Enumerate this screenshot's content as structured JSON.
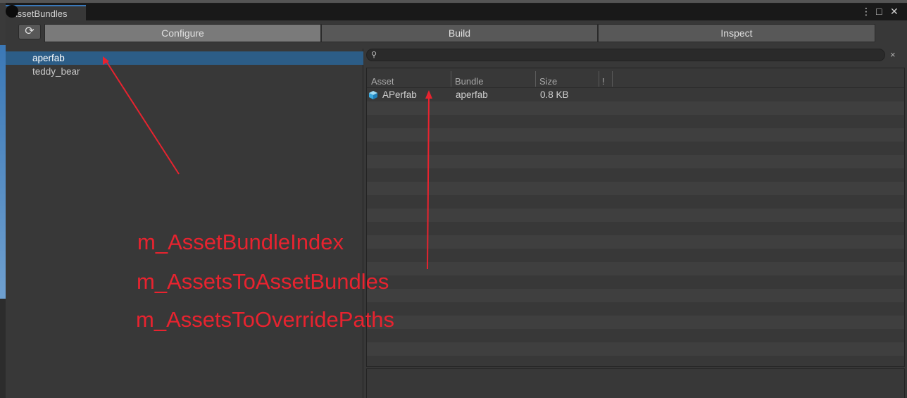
{
  "window": {
    "tab_title": "AssetBundles",
    "menu_glyph": "⋮",
    "maximize_glyph": "□",
    "close_glyph": "✕"
  },
  "toolbar": {
    "refresh_glyph": "⟳",
    "tabs": [
      "Configure",
      "Build",
      "Inspect"
    ],
    "active_tab": "Configure"
  },
  "bundles": {
    "items": [
      "aperfab",
      "teddy_bear"
    ],
    "selected": "aperfab"
  },
  "search": {
    "value": "",
    "search_glyph": "🔍",
    "clear_glyph": "×"
  },
  "asset_table": {
    "columns": [
      "Asset",
      "Bundle",
      "Size",
      "!"
    ],
    "rows": [
      {
        "icon": "prefab-icon",
        "asset": "APerfab",
        "bundle": "aperfab",
        "size": "0.8 KB"
      }
    ]
  },
  "annotations": {
    "labels": [
      "m_AssetBundleIndex",
      "m_AssetsToAssetBundles",
      "m_AssetsToOverridePaths"
    ],
    "color": "#e8232f"
  },
  "colors": {
    "selection": "#2c5d87",
    "tab_accent": "#3a79bb",
    "panel_bg": "#383838"
  }
}
